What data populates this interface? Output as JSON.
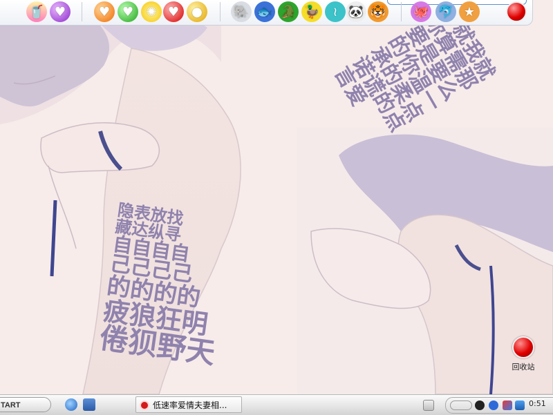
{
  "desktop": {
    "wallpaper": {
      "lyric_left_lines": [
        "隐表放找",
        "藏达纵寻",
        "自自自自",
        "己己己己",
        "的的的的",
        "疲狼狂明",
        "倦狈野天"
      ],
      "lyric_right_lines": [
        "的就我就",
        "你算需那",
        "要是要么",
        "的你温一",
        "承的柔点",
        "诺谎的点",
        "言爱"
      ]
    },
    "icons": [
      {
        "label": "回收站",
        "icon": "recycle-bin-icon"
      }
    ]
  },
  "dock": {
    "groups": [
      [
        "juice-glass-icon",
        "purple-heart-gem-icon"
      ],
      [
        "orange-heart-gem-icon",
        "green-heart-gem-icon",
        "lemon-slice-icon",
        "red-heart-gem-icon",
        "golden-apple-icon"
      ],
      [
        "elephant-icon",
        "blue-fish-icon",
        "crocodile-icon",
        "duck-icon",
        "seahorse-icon",
        "panda-icon",
        "tiger-icon"
      ],
      [
        "octopus-icon",
        "dolphin-icon",
        "starfish-icon"
      ],
      [
        "red-power-button-icon"
      ]
    ]
  },
  "taskbar": {
    "start_label": "TART",
    "quicklaunch": [
      "internet-explorer-icon",
      "show-desktop-icon"
    ],
    "task_title": "低速率爱情夫妻相...",
    "tray_icons": [
      "chevron-icon",
      "qq-penguin-icon",
      "msn-icon",
      "network-icon",
      "shield-icon"
    ],
    "clock": "0:51"
  },
  "colors": {
    "lyric": "#8f82ad",
    "background": "#f7ecea",
    "accent_red": "#e00000"
  }
}
